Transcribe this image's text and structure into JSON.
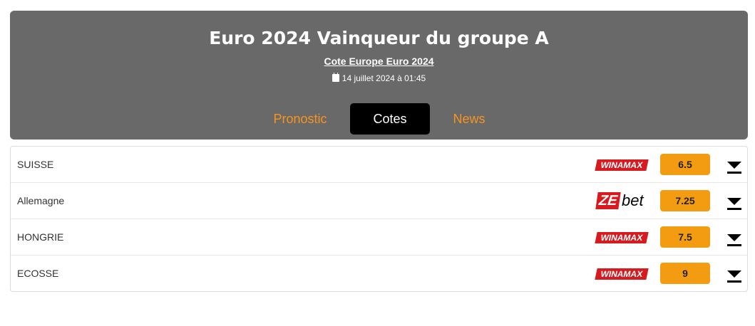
{
  "header": {
    "title": "Euro 2024 Vainqueur du groupe A",
    "subtitle_link": "Cote Europe Euro 2024",
    "date": "14 juillet 2024 à 01:45",
    "date_icon": "calendar-icon"
  },
  "tabs": [
    {
      "label": "Pronostic",
      "active": false
    },
    {
      "label": "Cotes",
      "active": true
    },
    {
      "label": "News",
      "active": false
    }
  ],
  "rows": [
    {
      "team": "SUISSE",
      "bookmaker": "WINAMAX",
      "odds": "6.5"
    },
    {
      "team": "Allemagne",
      "bookmaker": "ZEbet",
      "odds": "7.25"
    },
    {
      "team": "HONGRIE",
      "bookmaker": "WINAMAX",
      "odds": "7.5"
    },
    {
      "team": "ECOSSE",
      "bookmaker": "WINAMAX",
      "odds": "9"
    }
  ],
  "bookmaker_logos": {
    "winamax": "WINAMAX",
    "zebet_ze": "ZE",
    "zebet_bet": "bet"
  },
  "colors": {
    "header_bg": "#696969",
    "accent_orange": "#f7941d",
    "odds_bg": "#f39c12",
    "active_tab_bg": "#000000",
    "brand_red": "#d71920"
  },
  "icons": {
    "expand": "caret-down-icon"
  }
}
